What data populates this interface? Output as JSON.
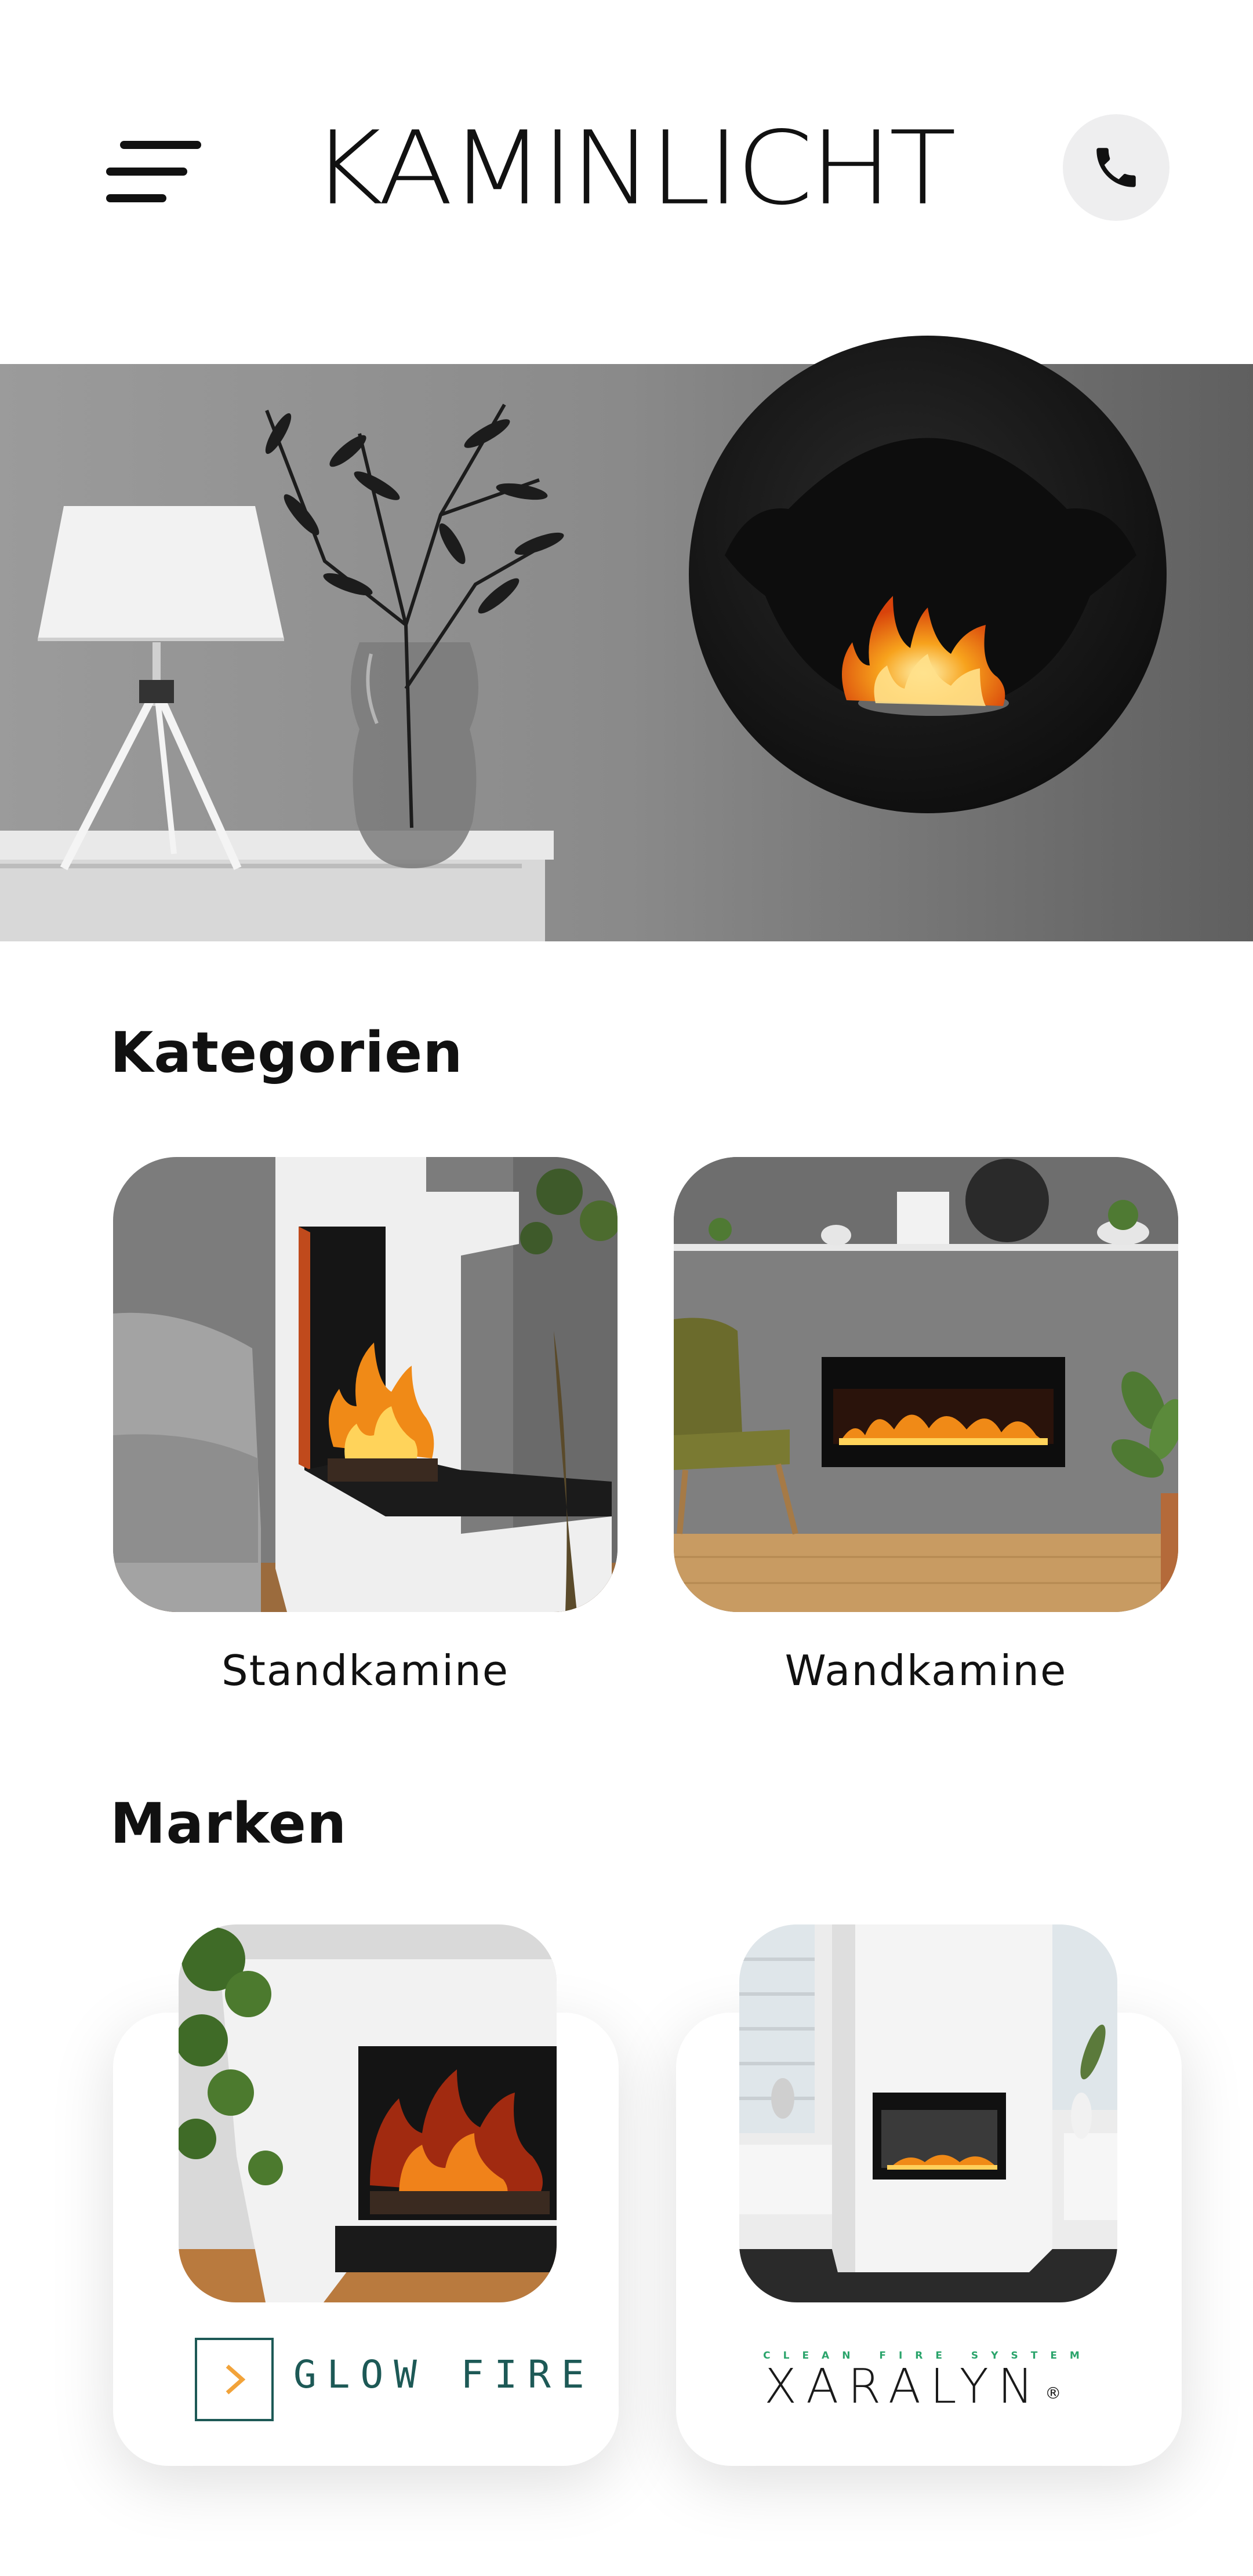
{
  "header": {
    "logo_text": "KAMINLICHT",
    "menu_icon": "hamburger-menu-icon",
    "phone_icon": "phone-icon"
  },
  "hero": {
    "image": "wall-mounted-round-fireplace-photo"
  },
  "categories": {
    "title": "Kategorien",
    "items": [
      {
        "label": "Standkamine",
        "image": "standing-fireplace-photo"
      },
      {
        "label": "Wandkamine",
        "image": "wall-fireplace-photo"
      }
    ]
  },
  "brands": {
    "title": "Marken",
    "items": [
      {
        "name": "GLOW FIRE",
        "image": "glow-fire-fireplace-photo"
      },
      {
        "name": "XARALYN",
        "tagline": "CLEAN FIRE SYSTEM",
        "image": "xaralyn-fireplace-photo"
      }
    ]
  },
  "colors": {
    "accent": "#e2442a",
    "phone_bg": "#eeeeef",
    "glowfire_teal": "#1d5956",
    "glowfire_orange": "#f2a33a",
    "xaralyn_green": "#2aa46b"
  }
}
